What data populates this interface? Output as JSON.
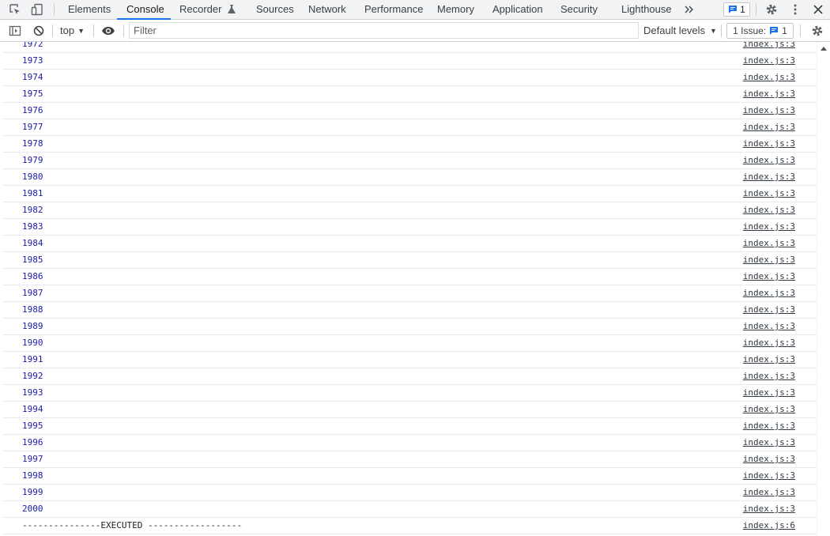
{
  "tabs": [
    {
      "label": "Elements"
    },
    {
      "label": "Console"
    },
    {
      "label": "Recorder"
    },
    {
      "label": "Sources"
    },
    {
      "label": "Network"
    },
    {
      "label": "Performance"
    },
    {
      "label": "Memory"
    },
    {
      "label": "Application"
    },
    {
      "label": "Security"
    },
    {
      "label": "Lighthouse"
    }
  ],
  "active_tab": "Console",
  "issues_badge": {
    "count": "1"
  },
  "toolbar": {
    "context": "top",
    "filter_placeholder": "Filter",
    "levels": "Default levels",
    "issues_label": "1 Issue:",
    "issues_count": "1"
  },
  "console": {
    "entries": [
      {
        "message": "1972",
        "source": "index.js:3",
        "kind": "number"
      },
      {
        "message": "1973",
        "source": "index.js:3",
        "kind": "number"
      },
      {
        "message": "1974",
        "source": "index.js:3",
        "kind": "number"
      },
      {
        "message": "1975",
        "source": "index.js:3",
        "kind": "number"
      },
      {
        "message": "1976",
        "source": "index.js:3",
        "kind": "number"
      },
      {
        "message": "1977",
        "source": "index.js:3",
        "kind": "number"
      },
      {
        "message": "1978",
        "source": "index.js:3",
        "kind": "number"
      },
      {
        "message": "1979",
        "source": "index.js:3",
        "kind": "number"
      },
      {
        "message": "1980",
        "source": "index.js:3",
        "kind": "number"
      },
      {
        "message": "1981",
        "source": "index.js:3",
        "kind": "number"
      },
      {
        "message": "1982",
        "source": "index.js:3",
        "kind": "number"
      },
      {
        "message": "1983",
        "source": "index.js:3",
        "kind": "number"
      },
      {
        "message": "1984",
        "source": "index.js:3",
        "kind": "number"
      },
      {
        "message": "1985",
        "source": "index.js:3",
        "kind": "number"
      },
      {
        "message": "1986",
        "source": "index.js:3",
        "kind": "number"
      },
      {
        "message": "1987",
        "source": "index.js:3",
        "kind": "number"
      },
      {
        "message": "1988",
        "source": "index.js:3",
        "kind": "number"
      },
      {
        "message": "1989",
        "source": "index.js:3",
        "kind": "number"
      },
      {
        "message": "1990",
        "source": "index.js:3",
        "kind": "number"
      },
      {
        "message": "1991",
        "source": "index.js:3",
        "kind": "number"
      },
      {
        "message": "1992",
        "source": "index.js:3",
        "kind": "number"
      },
      {
        "message": "1993",
        "source": "index.js:3",
        "kind": "number"
      },
      {
        "message": "1994",
        "source": "index.js:3",
        "kind": "number"
      },
      {
        "message": "1995",
        "source": "index.js:3",
        "kind": "number"
      },
      {
        "message": "1996",
        "source": "index.js:3",
        "kind": "number"
      },
      {
        "message": "1997",
        "source": "index.js:3",
        "kind": "number"
      },
      {
        "message": "1998",
        "source": "index.js:3",
        "kind": "number"
      },
      {
        "message": "1999",
        "source": "index.js:3",
        "kind": "number"
      },
      {
        "message": "2000",
        "source": "index.js:3",
        "kind": "number"
      },
      {
        "message": "---------------EXECUTED ------------------",
        "source": "index.js:6",
        "kind": "text"
      }
    ]
  },
  "icons": {
    "inspect": "inspect-element-icon",
    "device": "device-toolbar-icon",
    "more_tabs": "more-tabs-chevron-icon",
    "settings": "gear-icon",
    "menu": "vertical-dots-icon",
    "close": "close-icon",
    "sidebar": "show-sidebar-icon",
    "clear": "clear-console-icon",
    "live_expr": "eye-icon",
    "console_settings": "gear-icon",
    "message": "message-icon",
    "recorder": "flask-icon"
  },
  "colors": {
    "accent": "#1a73e8",
    "number": "#1a1aa6",
    "link": "#303942"
  }
}
